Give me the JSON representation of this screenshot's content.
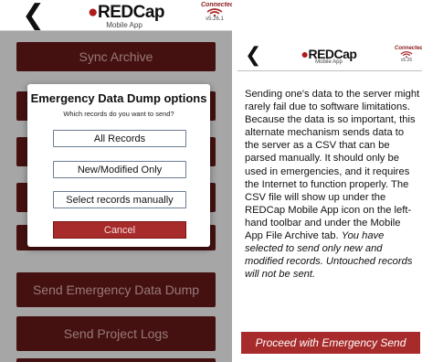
{
  "left": {
    "header": {
      "back_glyph": "❮",
      "logo_text": "REDCap",
      "logo_sub": "Mobile App",
      "conn_label": "Connected",
      "version": "v5.26.1"
    },
    "buttons": [
      {
        "label": "Sync Archive"
      },
      {
        "label": ""
      },
      {
        "label": ""
      },
      {
        "label": ""
      },
      {
        "label": ""
      },
      {
        "label": "Send Emergency Data Dump"
      },
      {
        "label": "Send Project Logs"
      },
      {
        "label": ""
      }
    ],
    "dialog": {
      "title": "Emergency Data Dump options",
      "subtitle": "Which records do you want to send?",
      "options": [
        "All Records",
        "New/Modified Only",
        "Select records manually"
      ],
      "cancel_label": "Cancel"
    }
  },
  "right": {
    "header": {
      "back_glyph": "❮",
      "logo_text": "REDCap",
      "logo_sub": "Mobile App",
      "conn_label": "Connected",
      "version": "v5.26"
    },
    "body_text": "Sending one's data to the server might rarely fail due to software limitations. Because the data is so important, this alternate mechanism sends data to the server as a CSV that can be parsed manually. It should only be used in emergencies, and it requires the Internet to function properly. The CSV file will show up under the REDCap Mobile App icon on the left-hand toolbar and under the Mobile App File Archive tab.",
    "body_italic": "You have selected to send only new and modified records. Untouched records will not be sent.",
    "proceed_label": "Proceed with Emergency Send"
  },
  "colors": {
    "button_dark_red": "#6a1a1a",
    "accent_red": "#a82b2b",
    "logo_red": "#b01c1c"
  }
}
